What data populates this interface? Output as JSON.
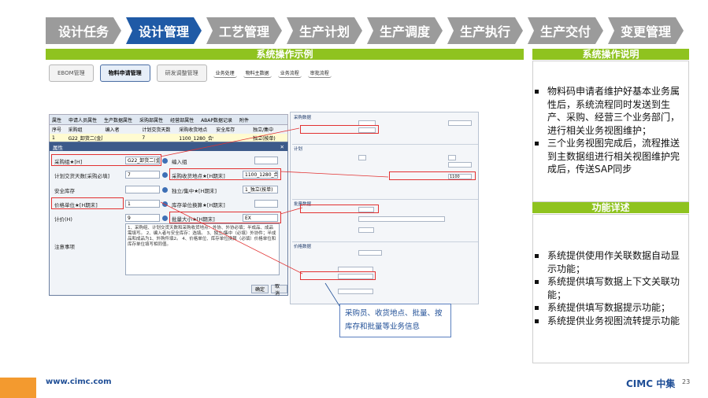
{
  "tabs": [
    {
      "label": "设计任务"
    },
    {
      "label": "设计管理"
    },
    {
      "label": "工艺管理"
    },
    {
      "label": "生产计划"
    },
    {
      "label": "生产调度"
    },
    {
      "label": "生产执行"
    },
    {
      "label": "生产交付"
    },
    {
      "label": "变更管理"
    }
  ],
  "left_title": "系统操作示例",
  "right_title": "系统操作说明",
  "func_title": "功能详述",
  "steps": [
    "EBOM管理",
    "物料申请管理",
    "研发调整管理",
    "业务处理",
    "物料主数据",
    "业务流程",
    "审批流程"
  ],
  "sap": {
    "menu": [
      "属性",
      "申请人员属性",
      "生产数据属性",
      "采购部属性",
      "经营部属性",
      "ABAP数据记录",
      "附件"
    ],
    "grid_head": [
      "序号",
      "采购组",
      "编入者",
      "计划交货天数",
      "采购收货地点",
      "安全库存",
      "独立/集中"
    ],
    "grid_row": [
      "1",
      "G22_卸货二(金属)",
      "",
      "7",
      "1100_1280_合作...",
      "",
      "独立(按单)"
    ],
    "dialog_title": "属性",
    "fields": [
      {
        "label": "采购组★[H]",
        "value": "G22_卸货二(金属)"
      },
      {
        "label": "编入组",
        "value": ""
      },
      {
        "label": "计划交货天数[采购必填]",
        "value": "7"
      },
      {
        "label": "采购收货地点★[H期末]",
        "value": "1100_1280_合..."
      },
      {
        "label": "安全库存",
        "value": ""
      },
      {
        "label": "独立/集中★[H期末]",
        "value": "1_独立(按单)"
      },
      {
        "label": "价格单位★[H期末]",
        "value": "1"
      },
      {
        "label": "库存单位换算★[H期末]",
        "value": ""
      },
      {
        "label": "计价(H)",
        "value": "9"
      },
      {
        "label": "批量大小★[H期末]",
        "value": "EX"
      }
    ],
    "notes_label": "注意事项",
    "notes": "1、采购组、计划交货天数和采购收货地点：外协、外协必填；半成品、成品需填写。 2、编入者与安全库存：选填。 3、独立/集中（必填）外协件；半成品和成品为1、外购件填2。 4、价格单位、库存单位换算（必填）价格单位和库存单位填写相同值。",
    "ok_label": "确定",
    "cancel_label": "取消"
  },
  "matview": {
    "sec1": "采购数据",
    "sec2": "计划",
    "sec3": "批量数据",
    "sec4": "价格数据",
    "sample_value": "1100"
  },
  "callout": "采购员、收货地点、批量、按库存和批量等业务信息",
  "bullets_top": [
    "物料码申请者维护好基本业务属性后，系统流程同时发送到生产、采购、经营三个业务部门，进行相关业务视图维护；",
    "三个业务视图完成后，流程推送到主数据组进行相关视图维护完成后，传送SAP同步"
  ],
  "bullets_bottom": [
    "系统提供使用作关联数据自动显示功能；",
    "系统提供填写数据上下文关联功能；",
    "系统提供填写数据提示功能；",
    "系统提供业务视图流转提示功能"
  ],
  "footer_url": "www.cimc.com",
  "footer_logo": "CIMC 中集",
  "page_number": "23",
  "colors": {
    "accent_blue": "#1f5aa6",
    "green": "#8fc31f",
    "tab_grey": "#9b9b9b",
    "orange": "#f39a2f",
    "red": "#e23131"
  }
}
